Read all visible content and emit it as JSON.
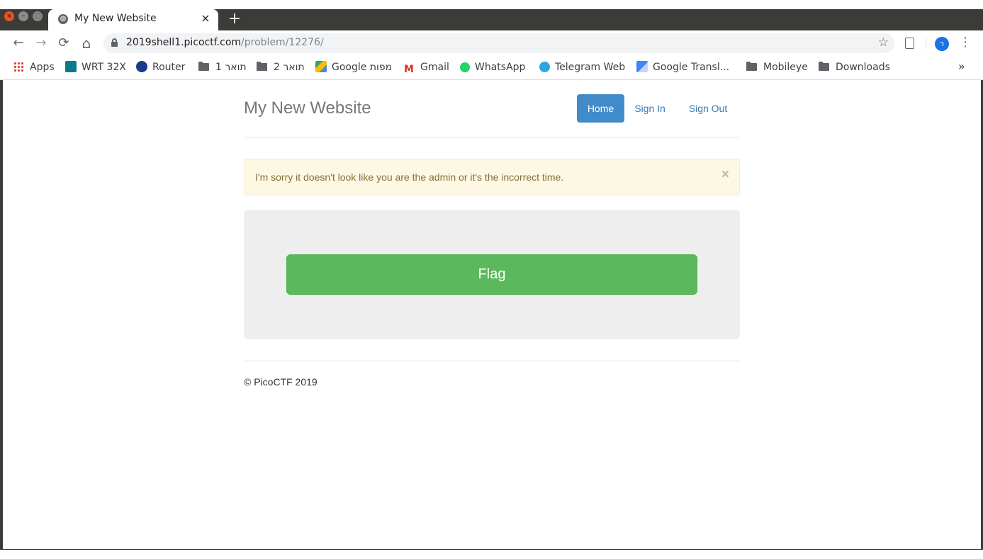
{
  "browser": {
    "tab": {
      "title": "My New Website",
      "close": "×"
    },
    "new_tab": "+",
    "nav": {
      "back": "←",
      "forward": "→",
      "reload": "⟳",
      "home": "⌂"
    },
    "url": {
      "host": "2019shell1.picoctf.com",
      "path": "/problem/12276/"
    },
    "star": "☆",
    "profile_initial": "ר",
    "menu": "⋮",
    "bookmarks": [
      {
        "label": "Apps",
        "icon": "apps-grid-icon"
      },
      {
        "label": "WRT 32X",
        "icon": "router-wifi-icon",
        "color": "#0a7a8c"
      },
      {
        "label": "Router",
        "icon": "router-b-icon",
        "color": "#1a3a8c"
      },
      {
        "label": "1 תואר",
        "icon": "folder-icon"
      },
      {
        "label": "2 תואר",
        "icon": "folder-icon"
      },
      {
        "label": "Google מפות",
        "icon": "maps-icon"
      },
      {
        "label": "Gmail",
        "icon": "gmail-icon",
        "color": "#d93025"
      },
      {
        "label": "WhatsApp",
        "icon": "whatsapp-icon",
        "color": "#25d366"
      },
      {
        "label": "Telegram Web",
        "icon": "telegram-icon",
        "color": "#2ca5e0"
      },
      {
        "label": "Google Transl...",
        "icon": "translate-icon",
        "color": "#4285f4"
      },
      {
        "label": "Mobileye",
        "icon": "folder-icon"
      },
      {
        "label": "Downloads",
        "icon": "folder-icon"
      }
    ],
    "bookmarks_more": "»"
  },
  "site": {
    "title": "My New Website",
    "nav": {
      "home": "Home",
      "sign_in": "Sign In",
      "sign_out": "Sign Out"
    },
    "alert": {
      "text": "I'm sorry it doesn't look like you are the admin or it's the incorrect time.",
      "close": "×"
    },
    "flag_button": "Flag",
    "footer": "© PicoCTF 2019"
  },
  "colors": {
    "primary": "#428bca",
    "link": "#337ab7",
    "success": "#5cb85c",
    "warning_bg": "#fcf8e3",
    "warning_text": "#8a6d3b"
  }
}
